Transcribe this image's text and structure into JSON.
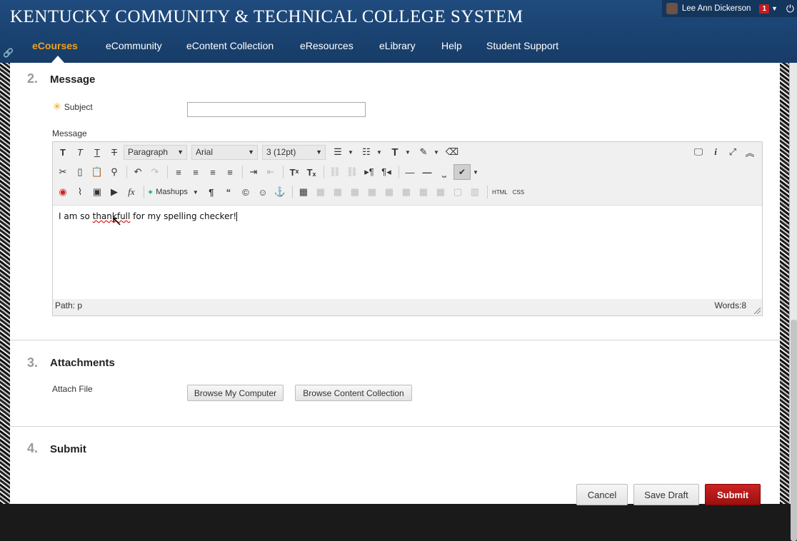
{
  "header": {
    "brand": "KENTUCKY COMMUNITY & TECHNICAL COLLEGE SYSTEM",
    "user_name": "Lee Ann Dickerson",
    "notification_count": "1",
    "nav": [
      "eCourses",
      "eCommunity",
      "eContent Collection",
      "eResources",
      "eLibrary",
      "Help",
      "Student Support"
    ],
    "active_nav": "eCourses"
  },
  "message_section": {
    "number": "2.",
    "title": "Message",
    "subject_label": "Subject",
    "subject_value": "",
    "message_label": "Message"
  },
  "editor": {
    "paragraph": "Paragraph",
    "font": "Arial",
    "size": "3 (12pt)",
    "mashups": "Mashups",
    "html_label": "HTML",
    "css_label": "CSS",
    "text_before": "I am so ",
    "misspelled_word": "thankfull",
    "text_after": " for my spelling checker!",
    "path": "Path: p",
    "words": "Words:8"
  },
  "attachments_section": {
    "number": "3.",
    "title": "Attachments",
    "attach_label": "Attach File",
    "browse_computer": "Browse My Computer",
    "browse_collection": "Browse Content Collection"
  },
  "submit_section": {
    "number": "4.",
    "title": "Submit",
    "cancel": "Cancel",
    "save_draft": "Save Draft",
    "submit": "Submit"
  },
  "colors": {
    "header_blue": "#1f4b7e",
    "active_nav": "#f0a11e",
    "submit_red": "#b01818"
  }
}
